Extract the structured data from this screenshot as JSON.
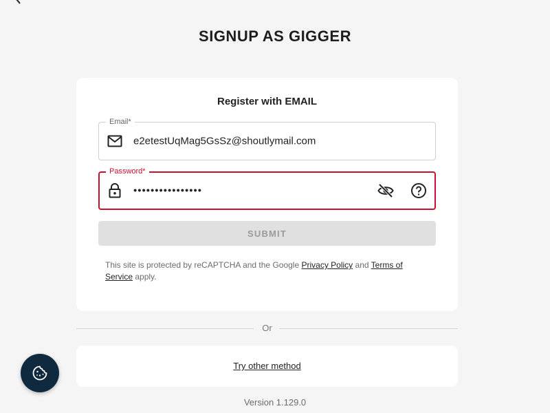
{
  "page": {
    "title": "SIGNUP AS GIGGER"
  },
  "form": {
    "heading": "Register with EMAIL",
    "email": {
      "label": "Email*",
      "value": "e2etestUqMag5GsSz@shoutlymail.com"
    },
    "password": {
      "label": "Password*",
      "value": "••••••••••••••••"
    },
    "submit_label": "SUBMIT",
    "recaptcha": {
      "text_before": "This site is protected by reCAPTCHA and the Google",
      "privacy_link": "Privacy Policy",
      "and": "and",
      "terms_link": "Terms of Service",
      "text_after": "apply."
    }
  },
  "divider": {
    "label": "Or"
  },
  "alternative": {
    "link_label": "Try other method"
  },
  "footer": {
    "version": "Version 1.129.0"
  },
  "icons": {
    "back": "chevron-left-icon",
    "email": "mail-icon",
    "password": "lock-icon",
    "visibility": "eye-off-icon",
    "help": "help-circle-icon",
    "cookie": "cookie-icon"
  },
  "colors": {
    "background": "#f5f5f5",
    "card": "#ffffff",
    "error": "#c8102e",
    "submit_disabled_bg": "#e0e0e0",
    "cookie_button": "#0f2a3f"
  }
}
